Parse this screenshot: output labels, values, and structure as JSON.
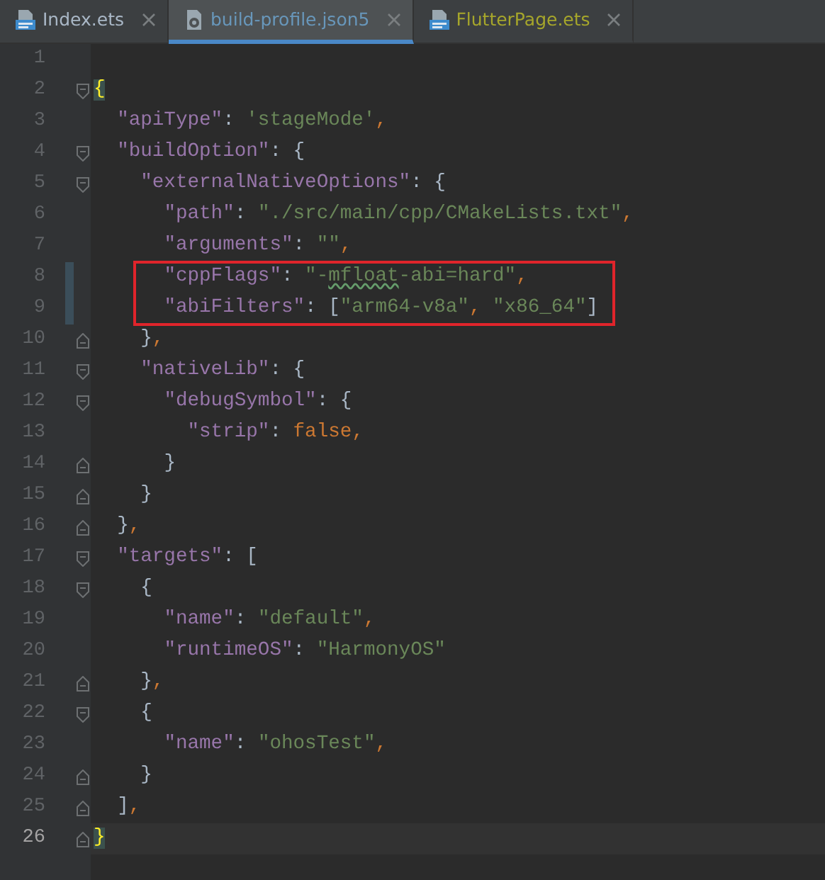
{
  "tabs": [
    {
      "label": "Index.ets",
      "kind": "ets",
      "selected": false,
      "color": "#a9b7c6"
    },
    {
      "label": "build-profile.json5",
      "kind": "json",
      "selected": true,
      "color": "#6897bb"
    },
    {
      "label": "FlutterPage.ets",
      "kind": "ets",
      "selected": false,
      "color": "#a6a62b"
    }
  ],
  "lines": [
    {
      "number": "1"
    },
    {
      "number": "2",
      "fold_start": true,
      "tokens": [
        {
          "kind": "open",
          "text": "{",
          "match": true
        }
      ]
    },
    {
      "number": "3",
      "tokens": [
        {
          "kind": "key",
          "text": "\"apiType\""
        },
        {
          "kind": "punct",
          "text": ": "
        },
        {
          "kind": "string",
          "text": "'stageMode'"
        },
        {
          "kind": "comma",
          "text": ","
        }
      ]
    },
    {
      "number": "4",
      "fold_start": true,
      "tokens": [
        {
          "kind": "key",
          "text": "\"buildOption\""
        },
        {
          "kind": "punct",
          "text": ": "
        },
        {
          "kind": "open",
          "text": "{"
        }
      ]
    },
    {
      "number": "5",
      "fold_start": true,
      "tokens": [
        {
          "kind": "key",
          "text": "\"externalNativeOptions\""
        },
        {
          "kind": "punct",
          "text": ": "
        },
        {
          "kind": "open",
          "text": "{"
        }
      ]
    },
    {
      "number": "6",
      "tokens": [
        {
          "kind": "key",
          "text": "\"path\""
        },
        {
          "kind": "punct",
          "text": ": "
        },
        {
          "kind": "string",
          "text": "\"./src/main/cpp/CMakeLists.txt\""
        },
        {
          "kind": "comma",
          "text": ","
        }
      ]
    },
    {
      "number": "7",
      "tokens": [
        {
          "kind": "key",
          "text": "\"arguments\""
        },
        {
          "kind": "punct",
          "text": ": "
        },
        {
          "kind": "string",
          "text": "\"\""
        },
        {
          "kind": "comma",
          "text": ","
        }
      ]
    },
    {
      "number": "8",
      "changed": true,
      "boxed": true,
      "tokens": [
        {
          "kind": "key",
          "text": "\"cppFlags\""
        },
        {
          "kind": "punct",
          "text": ": "
        },
        {
          "kind": "string",
          "text": "\"-"
        },
        {
          "kind": "string",
          "text": "mfloat",
          "typo": true
        },
        {
          "kind": "string",
          "text": "-abi=hard\""
        },
        {
          "kind": "comma",
          "text": ","
        }
      ]
    },
    {
      "number": "9",
      "changed": true,
      "boxed": true,
      "tokens": [
        {
          "kind": "key",
          "text": "\"abiFilters\""
        },
        {
          "kind": "punct",
          "text": ": "
        },
        {
          "kind": "bracket",
          "text": "["
        },
        {
          "kind": "string",
          "text": "\"arm64-v8a\""
        },
        {
          "kind": "comma",
          "text": ", "
        },
        {
          "kind": "string",
          "text": "\"x86_64\""
        },
        {
          "kind": "bracket",
          "text": "]"
        }
      ]
    },
    {
      "number": "10",
      "fold_end": true,
      "tokens": [
        {
          "kind": "close",
          "text": "}"
        },
        {
          "kind": "comma",
          "text": ","
        }
      ]
    },
    {
      "number": "11",
      "fold_start": true,
      "tokens": [
        {
          "kind": "key",
          "text": "\"nativeLib\""
        },
        {
          "kind": "punct",
          "text": ": "
        },
        {
          "kind": "open",
          "text": "{"
        }
      ]
    },
    {
      "number": "12",
      "fold_start": true,
      "tokens": [
        {
          "kind": "key",
          "text": "\"debugSymbol\""
        },
        {
          "kind": "punct",
          "text": ": "
        },
        {
          "kind": "open",
          "text": "{"
        }
      ]
    },
    {
      "number": "13",
      "tokens": [
        {
          "kind": "key",
          "text": "\"strip\""
        },
        {
          "kind": "punct",
          "text": ": "
        },
        {
          "kind": "keyword",
          "text": "false"
        },
        {
          "kind": "comma",
          "text": ","
        }
      ]
    },
    {
      "number": "14",
      "fold_end": true,
      "tokens": [
        {
          "kind": "close",
          "text": "}"
        }
      ]
    },
    {
      "number": "15",
      "fold_end": true,
      "tokens": [
        {
          "kind": "close",
          "text": "}"
        }
      ]
    },
    {
      "number": "16",
      "fold_end": true,
      "tokens": [
        {
          "kind": "close",
          "text": "}"
        },
        {
          "kind": "comma",
          "text": ","
        }
      ]
    },
    {
      "number": "17",
      "fold_start": true,
      "tokens": [
        {
          "kind": "key",
          "text": "\"targets\""
        },
        {
          "kind": "punct",
          "text": ": "
        },
        {
          "kind": "open",
          "text": "["
        }
      ]
    },
    {
      "number": "18",
      "fold_start": true,
      "tokens": [
        {
          "kind": "open",
          "text": "{"
        }
      ]
    },
    {
      "number": "19",
      "tokens": [
        {
          "kind": "key",
          "text": "\"name\""
        },
        {
          "kind": "punct",
          "text": ": "
        },
        {
          "kind": "string",
          "text": "\"default\""
        },
        {
          "kind": "comma",
          "text": ","
        }
      ]
    },
    {
      "number": "20",
      "tokens": [
        {
          "kind": "key",
          "text": "\"runtimeOS\""
        },
        {
          "kind": "punct",
          "text": ": "
        },
        {
          "kind": "string",
          "text": "\"HarmonyOS\""
        }
      ]
    },
    {
      "number": "21",
      "fold_end": true,
      "tokens": [
        {
          "kind": "close",
          "text": "}"
        },
        {
          "kind": "comma",
          "text": ","
        }
      ]
    },
    {
      "number": "22",
      "fold_start": true,
      "tokens": [
        {
          "kind": "open",
          "text": "{"
        }
      ]
    },
    {
      "number": "23",
      "tokens": [
        {
          "kind": "key",
          "text": "\"name\""
        },
        {
          "kind": "punct",
          "text": ": "
        },
        {
          "kind": "string",
          "text": "\"ohosTest\""
        },
        {
          "kind": "comma",
          "text": ","
        }
      ]
    },
    {
      "number": "24",
      "fold_end": true,
      "tokens": [
        {
          "kind": "close",
          "text": "}"
        }
      ]
    },
    {
      "number": "25",
      "fold_end": true,
      "tokens": [
        {
          "kind": "close",
          "text": "]"
        },
        {
          "kind": "comma",
          "text": ","
        }
      ]
    },
    {
      "number": "26",
      "fold_end": true,
      "current": true,
      "tokens": [
        {
          "kind": "close",
          "text": "}",
          "match": true
        }
      ]
    }
  ]
}
